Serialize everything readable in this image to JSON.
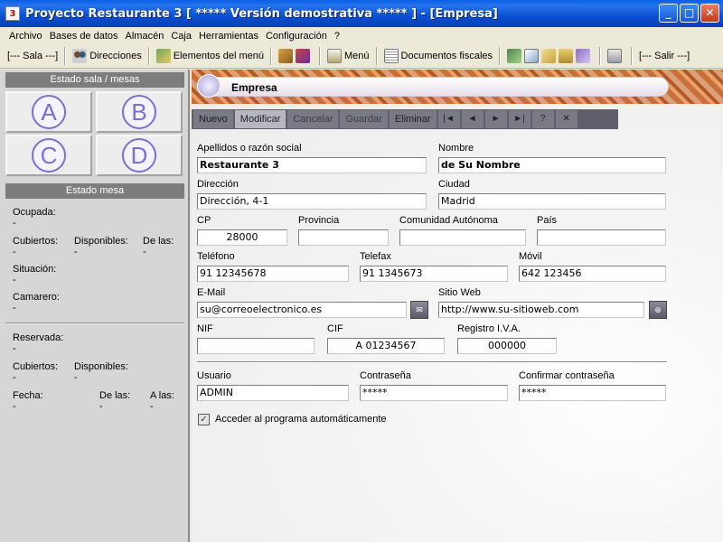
{
  "window": {
    "title": "Proyecto Restaurante 3 [ ***** Versión demostrativa ***** ] - [Empresa]",
    "minimize": "_",
    "maximize": "□",
    "close": "✕"
  },
  "menu": [
    "Archivo",
    "Bases de datos",
    "Almacén",
    "Caja",
    "Herramientas",
    "Configuración",
    "?"
  ],
  "toolbar": {
    "sala": "[--- Sala ---]",
    "direcciones": "Direcciones",
    "elementos_menu": "Elementos del menú",
    "menu": "Menú",
    "documentos_fiscales": "Documentos fiscales",
    "salir": "[--- Salir ---]"
  },
  "left": {
    "estado_sala_header": "Estado sala / mesas",
    "salas": [
      "A",
      "B",
      "C",
      "D"
    ],
    "estado_mesa_header": "Estado mesa",
    "ocupada": "Ocupada:",
    "cubiertos": "Cubiertos:",
    "disponibles": "Disponibles:",
    "de_las": "De las:",
    "situacion": "Situación:",
    "camarero": "Camarero:",
    "reservada": "Reservada:",
    "fecha": "Fecha:",
    "a_las": "A las:",
    "dash": "-"
  },
  "form": {
    "title": "Empresa",
    "actions": [
      "Nuevo",
      "Modificar",
      "Cancelar",
      "Guardar",
      "Eliminar"
    ],
    "nav": [
      "|◄",
      "◄",
      "►",
      "►|",
      "?",
      "✕"
    ],
    "labels": {
      "razon_social": "Apellidos o razón social",
      "nombre": "Nombre",
      "direccion": "Dirección",
      "ciudad": "Ciudad",
      "cp": "CP",
      "provincia": "Provincia",
      "comunidad": "Comunidad Autónoma",
      "pais": "País",
      "telefono": "Teléfono",
      "telefax": "Telefax",
      "movil": "Móvil",
      "email": "E-Mail",
      "sitio_web": "Sitio Web",
      "nif": "NIF",
      "cif": "CIF",
      "registro_iva": "Registro I.V.A.",
      "usuario": "Usuario",
      "contrasena": "Contraseña",
      "confirmar": "Confirmar contraseña",
      "acceder": "Acceder al programa automáticamente"
    },
    "values": {
      "razon_social": "Restaurante 3",
      "nombre": "de Su Nombre",
      "direccion": "Dirección, 4-1",
      "ciudad": "Madrid",
      "cp": "28000",
      "provincia": "",
      "comunidad": "",
      "pais": "",
      "telefono": "91 12345678",
      "telefax": "91 1345673",
      "movil": "642 123456",
      "email": "su@correoelectronico.es",
      "sitio_web": "http://www.su-sitioweb.com",
      "nif": "",
      "cif": "A 01234567",
      "registro_iva": "000000",
      "usuario": "ADMIN",
      "contrasena": "*****",
      "confirmar": "*****",
      "check_mark": "✓"
    }
  }
}
